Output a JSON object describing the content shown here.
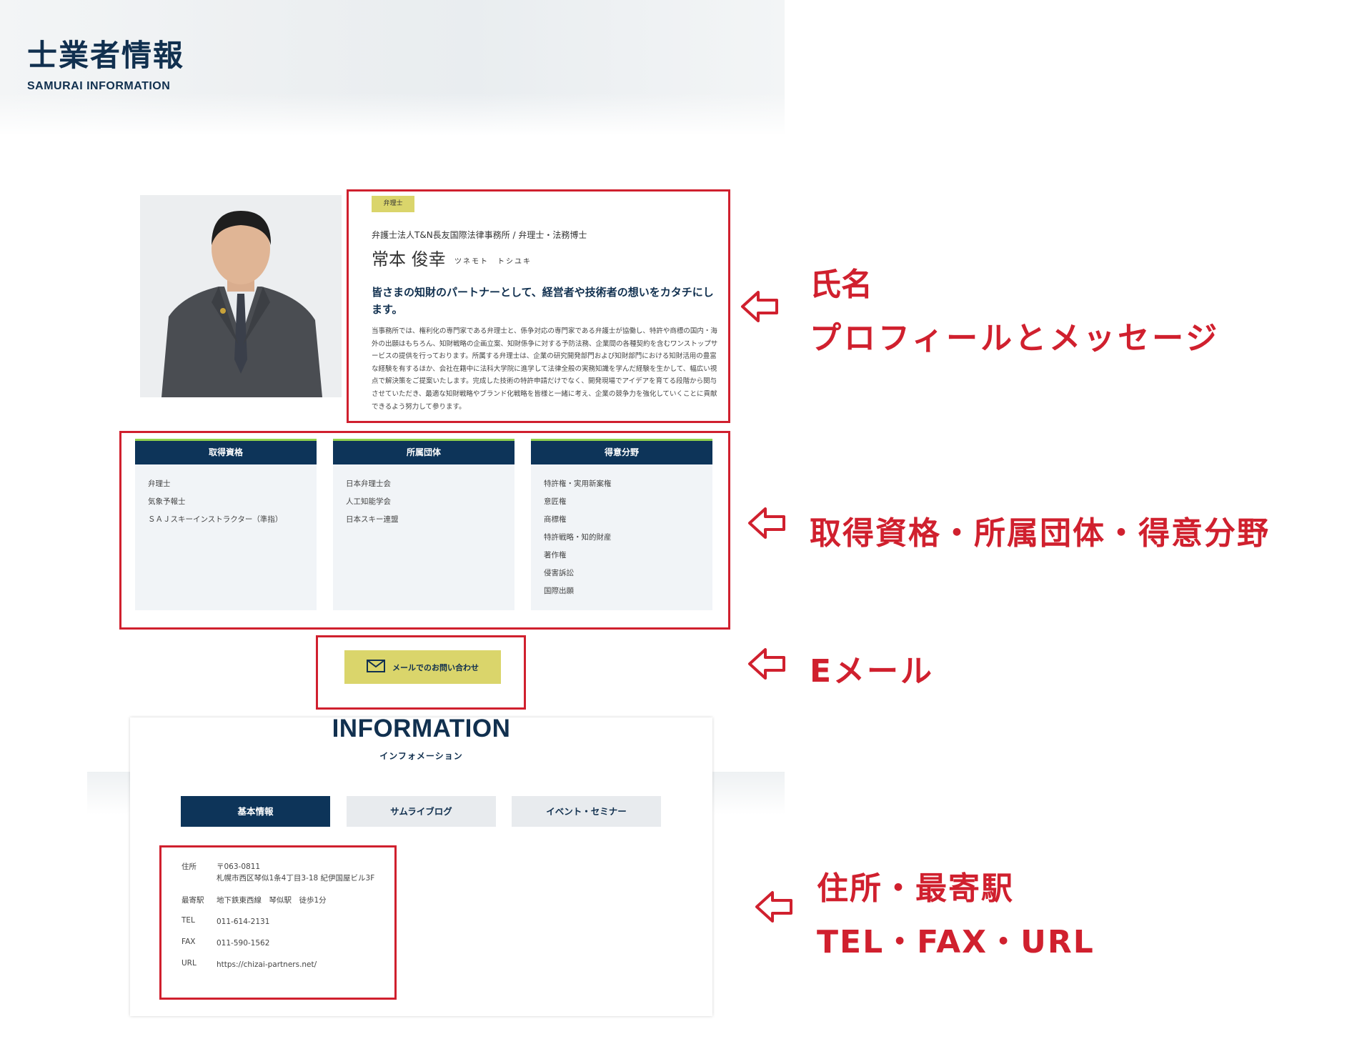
{
  "header": {
    "title": "士業者情報",
    "subtitle": "SAMURAI INFORMATION"
  },
  "profile": {
    "tag": "弁理士",
    "firm_line": "弁護士法人T&N長友国際法律事務所 / 弁理士・法務博士",
    "name": "常本 俊幸",
    "kana": "ツネモト　トシユキ",
    "headline": "皆さまの知財のパートナーとして、経営者や技術者の想いをカタチにします。",
    "body": "当事務所では、権利化の専門家である弁理士と、係争対応の専門家である弁護士が協働し、特許や商標の国内・海外の出願はもちろん、知財戦略の企画立案、知財係争に対する予防法務、企業間の各種契約を含むワンストップサービスの提供を行っております。所属する弁理士は、企業の研究開発部門および知財部門における知財活用の豊富な経験を有するほか、会社在籍中に法科大学院に進学して法律全般の実務知識を学んだ経験を生かして、幅広い視点で解決策をご提案いたします。完成した技術の特許申請だけでなく、開発現場でアイデアを育てる段階から関与させていただき、最適な知財戦略やブランド化戦略を皆様と一緒に考え、企業の競争力を強化していくことに貢献できるよう努力して参ります。"
  },
  "cards": [
    {
      "title": "取得資格",
      "items": [
        "弁理士",
        "気象予報士",
        "ＳＡＪスキーインストラクター（準指）"
      ]
    },
    {
      "title": "所属団体",
      "items": [
        "日本弁理士会",
        "人工知能学会",
        "日本スキー連盟"
      ]
    },
    {
      "title": "得意分野",
      "items": [
        "特許権・実用新案権",
        "意匠権",
        "商標権",
        "特許戦略・知的財産",
        "著作権",
        "侵害訴訟",
        "国際出願"
      ]
    }
  ],
  "mail_button": {
    "label": "メールでのお問い合わせ",
    "icon": "envelope-icon"
  },
  "information": {
    "title": "INFORMATION",
    "subtitle": "インフォメーション",
    "tabs": [
      "基本情報",
      "サムライブログ",
      "イベント・セミナー"
    ],
    "active_tab": 0,
    "rows": {
      "address_label": "住所",
      "address_zip": "〒063-0811",
      "address_line": "札幌市西区琴似1条4丁目3-18 紀伊国屋ビル3F",
      "station_label": "最寄駅",
      "station_value": "地下鉄東西線　琴似駅　徒歩1分",
      "tel_label": "TEL",
      "tel_value": "011-614-2131",
      "fax_label": "FAX",
      "fax_value": "011-590-1562",
      "url_label": "URL",
      "url_value": "https://chizai-partners.net/"
    }
  },
  "annotations": {
    "name_line1": "氏名",
    "name_line2": "プロフィールとメッセージ",
    "cards": "取得資格・所属団体・得意分野",
    "email": "Eメール",
    "address_line1": "住所・最寄駅",
    "address_line2": "TEL・FAX・URL"
  },
  "colors": {
    "navy": "#0d3459",
    "accent_yellow": "#dad56b",
    "annotation_red": "#d0202e",
    "card_top_green": "#8fd04c"
  }
}
